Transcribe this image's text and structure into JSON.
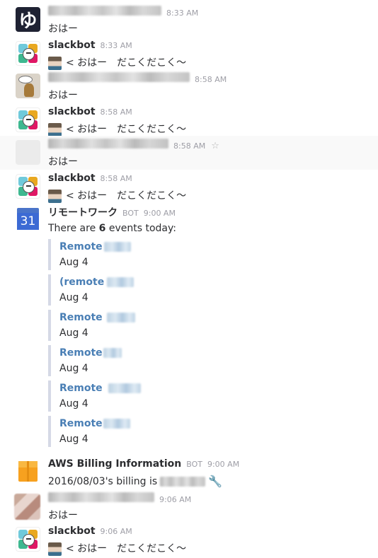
{
  "messages": [
    {
      "time": "8:33 AM",
      "text": "おはー"
    },
    {
      "name": "slackbot",
      "time": "8:33 AM",
      "text": "< おはー　だこくだこく〜"
    },
    {
      "time": "8:58 AM",
      "text": "おはー"
    },
    {
      "name": "slackbot",
      "time": "8:58 AM",
      "text": "< おはー　だこくだこく〜"
    },
    {
      "time": "8:58 AM",
      "text": "おはー",
      "star": "☆"
    },
    {
      "name": "slackbot",
      "time": "8:58 AM",
      "text": "< おはー　だこくだこく〜"
    },
    {
      "name": "リモートワーク",
      "bot": "BOT",
      "time": "9:00 AM",
      "text_pre": "There are ",
      "text_bold": "6",
      "text_post": " events today:",
      "avatar_day": "31"
    },
    {
      "name": "AWS Billing Information",
      "bot": "BOT",
      "time": "9:00 AM",
      "text": "2016/08/03's billing is"
    },
    {
      "time": "9:06 AM",
      "text": "おはー"
    },
    {
      "name": "slackbot",
      "time": "9:06 AM",
      "text": "< おはー　だこくだこく〜"
    }
  ],
  "events": [
    {
      "title": "Remote",
      "date": "Aug 4"
    },
    {
      "title": "(remote",
      "date": "Aug 4"
    },
    {
      "title": "Remote",
      "date": "Aug 4"
    },
    {
      "title": "Remote",
      "date": "Aug 4"
    },
    {
      "title": "Remote",
      "date": "Aug 4"
    },
    {
      "title": "Remote",
      "date": "Aug 4"
    }
  ],
  "avatar_glyph": "ゆ",
  "colors": {
    "link": "#4a7fb5",
    "attachment_bar": "#d5d9e6",
    "aws_orange": "#f7a11f",
    "calendar_blue": "#3c6ad4"
  },
  "icons": [
    "yu-avatar-icon",
    "slackbot-avatar-icon",
    "star-icon",
    "calendar-icon",
    "aws-box-icon",
    "tool-icon"
  ]
}
